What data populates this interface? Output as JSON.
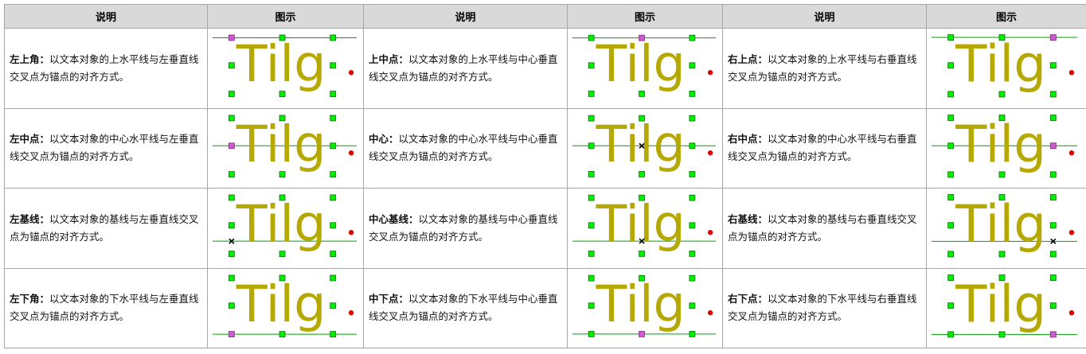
{
  "headers": [
    "说明",
    "图示",
    "说明",
    "图示",
    "说明",
    "图示"
  ],
  "sample_text": "Tilg",
  "colors": {
    "text": "#b5a800",
    "line": "#00a000",
    "handle": "#00ee00",
    "anchor": "#d05ad0",
    "rotate": "#e00000",
    "cross": "#000000"
  },
  "rows": [
    [
      {
        "name": "左上角：",
        "text": "以文本对象的上水平线与左垂直线交叉点为锚点的对齐方式。",
        "h": "left",
        "v": "top"
      },
      {
        "name": "上中点：",
        "text": "以文本对象的上水平线与中心垂直线交叉点为锚点的对齐方式。",
        "h": "center",
        "v": "top"
      },
      {
        "name": "右上点：",
        "text": "以文本对象的上水平线与右垂直线交叉点为锚点的对齐方式。",
        "h": "right",
        "v": "top"
      }
    ],
    [
      {
        "name": "左中点：",
        "text": "以文本对象的中心水平线与左垂直线交叉点为锚点的对齐方式。",
        "h": "left",
        "v": "middle"
      },
      {
        "name": "中心：",
        "text": "以文本对象的中心水平线与中心垂直线交叉点为锚点的对齐方式。",
        "h": "center",
        "v": "middle"
      },
      {
        "name": "右中点：",
        "text": "以文本对象的中心水平线与右垂直线交叉点为锚点的对齐方式。",
        "h": "right",
        "v": "middle"
      }
    ],
    [
      {
        "name": "左基线：",
        "text": "以文本对象的基线与左垂直线交叉点为锚点的对齐方式。",
        "h": "left",
        "v": "baseline"
      },
      {
        "name": "中心基线：",
        "text": "以文本对象的基线与中心垂直线交叉点为锚点的对齐方式。",
        "h": "center",
        "v": "baseline"
      },
      {
        "name": "右基线：",
        "text": "以文本对象的基线与右垂直线交叉点为锚点的对齐方式。",
        "h": "right",
        "v": "baseline"
      }
    ],
    [
      {
        "name": "左下角：",
        "text": "以文本对象的下水平线与左垂直线交叉点为锚点的对齐方式。",
        "h": "left",
        "v": "bottom"
      },
      {
        "name": "中下点：",
        "text": "以文本对象的下水平线与中心垂直线交叉点为锚点的对齐方式。",
        "h": "center",
        "v": "bottom"
      },
      {
        "name": "右下点：",
        "text": "以文本对象的下水平线与右垂直线交叉点为锚点的对齐方式。",
        "h": "right",
        "v": "bottom"
      }
    ]
  ]
}
